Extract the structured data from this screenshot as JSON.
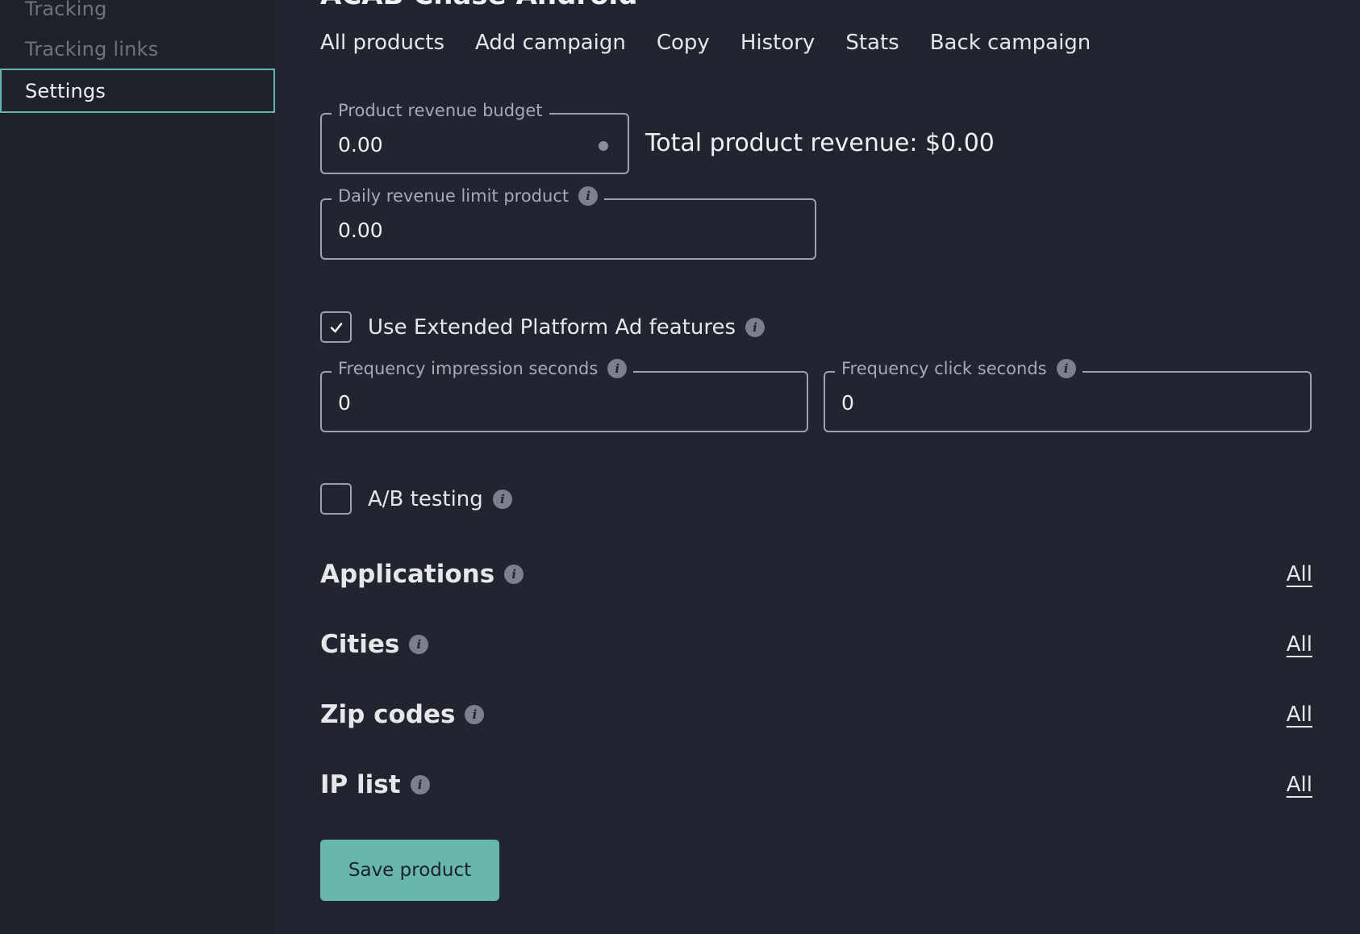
{
  "sidebar": {
    "items": [
      {
        "label": "Tracking"
      },
      {
        "label": "Tracking links"
      },
      {
        "label": "Settings"
      }
    ]
  },
  "header": {
    "title": "ACAB Chase Android",
    "tabs": [
      {
        "label": "All products"
      },
      {
        "label": "Add campaign"
      },
      {
        "label": "Copy"
      },
      {
        "label": "History"
      },
      {
        "label": "Stats"
      },
      {
        "label": "Back campaign"
      }
    ]
  },
  "form": {
    "revenue_budget": {
      "label": "Product revenue budget",
      "value": "0.00"
    },
    "total_revenue": "Total product revenue: $0.00",
    "daily_limit": {
      "label": "Daily revenue limit product",
      "value": "0.00"
    },
    "extended_features": {
      "label": "Use Extended Platform Ad features",
      "checked": true
    },
    "freq_impression": {
      "label": "Frequency impression seconds",
      "value": "0"
    },
    "freq_click": {
      "label": "Frequency click seconds",
      "value": "0"
    },
    "ab_testing": {
      "label": "A/B testing",
      "checked": false
    }
  },
  "sections": [
    {
      "title": "Applications",
      "link": "All"
    },
    {
      "title": "Cities",
      "link": "All"
    },
    {
      "title": "Zip codes",
      "link": "All"
    },
    {
      "title": "IP list",
      "link": "All"
    }
  ],
  "actions": {
    "save_label": "Save product"
  },
  "colors": {
    "accent": "#67b7ad",
    "background": "#222430",
    "sidebar": "#1f212b"
  }
}
